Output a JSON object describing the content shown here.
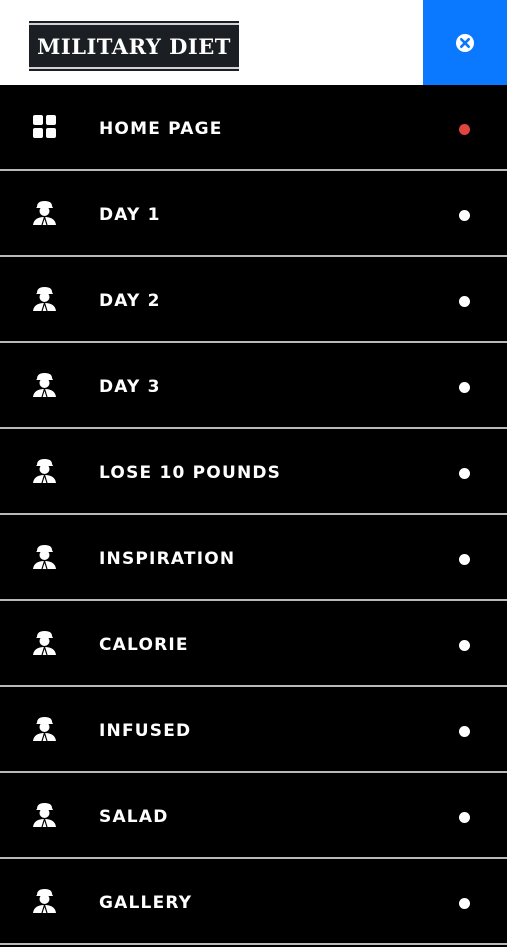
{
  "header": {
    "logo_text": "MILITARY DIET",
    "close_icon": "close-circle-icon",
    "accent_color": "#0a78ff"
  },
  "menu": {
    "items": [
      {
        "label": "HOME PAGE",
        "icon": "grid-icon",
        "indicator_color": "#e0453f"
      },
      {
        "label": "DAY 1",
        "icon": "soldier-icon",
        "indicator_color": "#ffffff"
      },
      {
        "label": "DAY 2",
        "icon": "soldier-icon",
        "indicator_color": "#ffffff"
      },
      {
        "label": "DAY 3",
        "icon": "soldier-icon",
        "indicator_color": "#ffffff"
      },
      {
        "label": "LOSE 10 POUNDS",
        "icon": "soldier-icon",
        "indicator_color": "#ffffff"
      },
      {
        "label": "INSPIRATION",
        "icon": "soldier-icon",
        "indicator_color": "#ffffff"
      },
      {
        "label": "CALORIE",
        "icon": "soldier-icon",
        "indicator_color": "#ffffff"
      },
      {
        "label": "INFUSED",
        "icon": "soldier-icon",
        "indicator_color": "#ffffff"
      },
      {
        "label": "SALAD",
        "icon": "soldier-icon",
        "indicator_color": "#ffffff"
      },
      {
        "label": "GALLERY",
        "icon": "soldier-icon",
        "indicator_color": "#ffffff"
      }
    ]
  }
}
